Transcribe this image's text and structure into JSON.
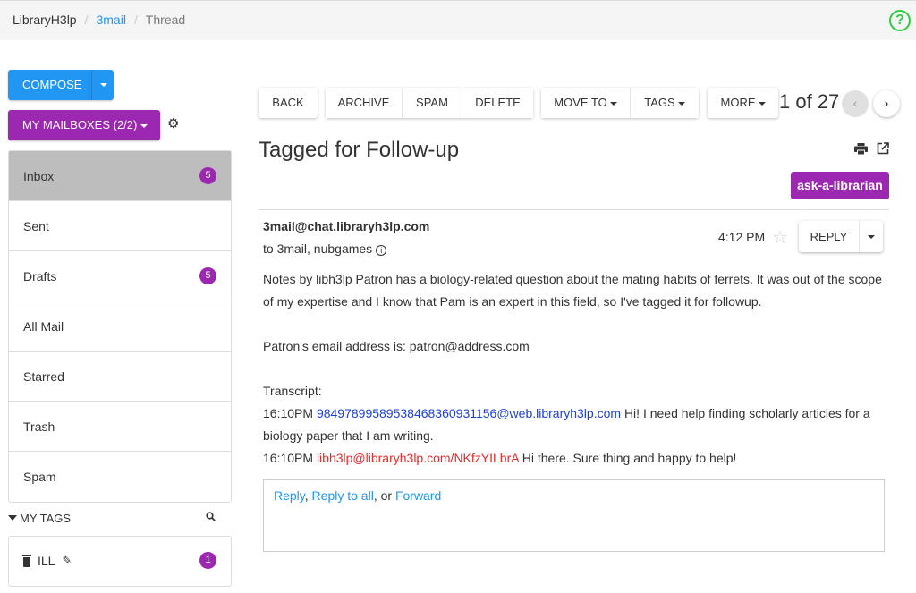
{
  "header": {
    "breadcrumb": [
      {
        "label": "LibraryH3lp"
      },
      {
        "label": "3mail"
      },
      {
        "label": "Thread"
      }
    ],
    "separator": "/",
    "help_icon": "?"
  },
  "sidebar": {
    "compose_label": "COMPOSE",
    "mailboxes_label": "MY MAILBOXES (2/2)",
    "mailboxes": [
      {
        "label": "Inbox",
        "count": "5",
        "active": true
      },
      {
        "label": "Sent",
        "count": null
      },
      {
        "label": "Drafts",
        "count": "5"
      },
      {
        "label": "All Mail",
        "count": null
      },
      {
        "label": "Starred",
        "count": null
      },
      {
        "label": "Trash",
        "count": null
      },
      {
        "label": "Spam",
        "count": null
      }
    ],
    "tags_header": "MY TAGS",
    "tags": [
      {
        "label": "ILL",
        "count": "1"
      }
    ]
  },
  "toolbar": {
    "back": "BACK",
    "archive": "ARCHIVE",
    "spam": "SPAM",
    "delete": "DELETE",
    "move_to": "MOVE TO",
    "tags": "TAGS",
    "more": "MORE",
    "pager": "1 of 27"
  },
  "thread": {
    "title": "Tagged for Follow-up",
    "tag_chip": "ask-a-librarian",
    "tag_color": "#9c27b0",
    "message": {
      "from": "3mail@chat.libraryh3lp.com",
      "to": "to 3mail, nubgames",
      "time": "4:12 PM",
      "reply_label": "REPLY",
      "notes": "Notes by libh3lp Patron has a biology-related question about the mating habits of ferrets. It was out of the scope of my expertise and I know that Pam is an expert in this field, so I've tagged it for followup.",
      "email_line": "Patron's email address is: patron@address.com",
      "transcript_label": "Transcript:",
      "transcript": [
        {
          "time": "16:10PM",
          "from": "9849789958953846836093115​6@web.libraryh3lp.com",
          "text": "Hi! I need help finding scholarly articles for a biology paper that I am writing."
        },
        {
          "time": "16:10PM",
          "from": "libh3lp@libraryh3lp.com/NKfzYILbrA",
          "text": "Hi there. Sure thing and happy to help!"
        }
      ]
    },
    "reply_box": {
      "reply": "Reply",
      "reply_all": "Reply to all",
      "sep1": ", ",
      "or": ", or ",
      "forward": "Forward"
    }
  }
}
